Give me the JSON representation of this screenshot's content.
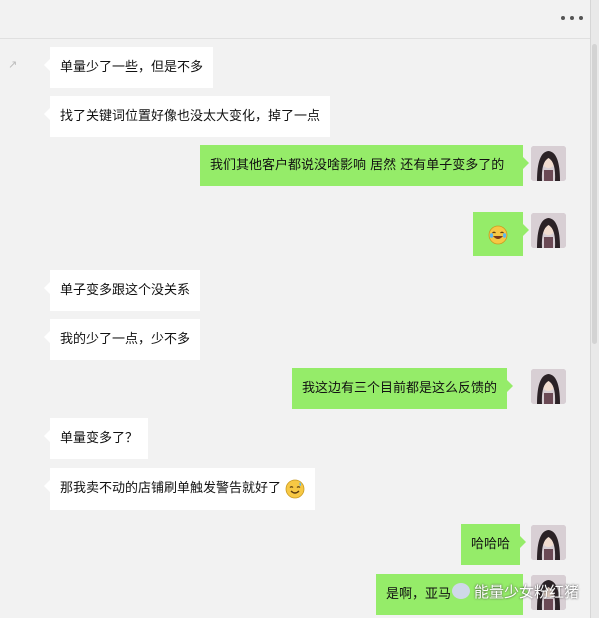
{
  "header": {
    "more_icon": "more-dots-icon"
  },
  "messages": [
    {
      "side": "in",
      "text": "单量少了一些，但是不多"
    },
    {
      "side": "in",
      "text": "找了关键词位置好像也没太大变化，掉了一点"
    },
    {
      "side": "out",
      "text": "我们其他客户都说没啥影响 居然 还有单子变多了的"
    },
    {
      "side": "out",
      "text": "",
      "emoji": "laughing-tears-emoji"
    },
    {
      "side": "in",
      "text": "单子变多跟这个没关系"
    },
    {
      "side": "in",
      "text": "我的少了一点，少不多"
    },
    {
      "side": "out",
      "text": "我这边有三个目前都是这么反馈的"
    },
    {
      "side": "in",
      "text": "单量变多了？"
    },
    {
      "side": "in",
      "text": "那我卖不动的店铺刷单触发警告就好了",
      "emoji": "sweat-smile-emoji"
    },
    {
      "side": "out",
      "text": "哈哈哈"
    },
    {
      "side": "out",
      "text": "是啊，亚马"
    }
  ],
  "watermark": {
    "text": "能量少女粉红猪",
    "icon": "wechat-official-account-icon"
  },
  "colors": {
    "outgoing": "#95ec69",
    "incoming": "#ffffff",
    "background": "#f2f2f2"
  }
}
